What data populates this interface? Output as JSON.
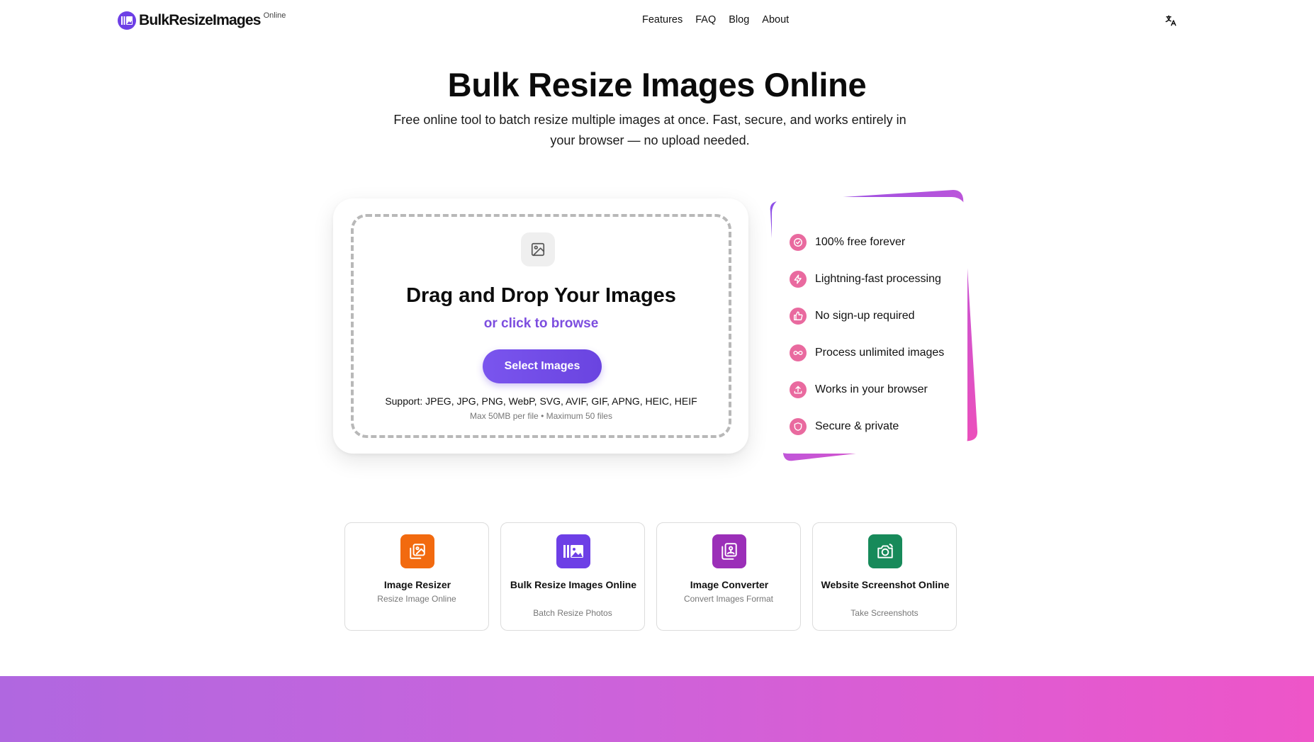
{
  "header": {
    "logo_text": "BulkResizeImages",
    "logo_sup": "Online",
    "nav": [
      "Features",
      "FAQ",
      "Blog",
      "About"
    ]
  },
  "hero": {
    "title": "Bulk Resize Images Online",
    "subtitle": "Free online tool to batch resize multiple images at once. Fast, secure, and works entirely in your browser — no upload needed."
  },
  "upload": {
    "title": "Drag and Drop Your Images",
    "browse": "or click to browse",
    "button": "Select Images",
    "support": "Support: JPEG, JPG, PNG, WebP, SVG, AVIF, GIF, APNG, HEIC, HEIF",
    "limits": "Max 50MB per file • Maximum 50 files"
  },
  "features": [
    {
      "label": "100% free forever",
      "icon": "check-badge-icon"
    },
    {
      "label": "Lightning-fast processing",
      "icon": "lightning-icon"
    },
    {
      "label": "No sign-up required",
      "icon": "thumbs-up-icon"
    },
    {
      "label": "Process unlimited images",
      "icon": "infinity-icon"
    },
    {
      "label": "Works in your browser",
      "icon": "upload-icon"
    },
    {
      "label": "Secure & private",
      "icon": "shield-icon"
    }
  ],
  "tools": [
    {
      "title": "Image Resizer",
      "sub": "Resize Image Online",
      "color": "#f26a0f"
    },
    {
      "title": "Bulk Resize Images Online",
      "sub": "Batch Resize Photos",
      "color": "#6d3fe6"
    },
    {
      "title": "Image Converter",
      "sub": "Convert Images Format",
      "color": "#9b2fb8"
    },
    {
      "title": "Website Screenshot Online",
      "sub": "Take Screenshots",
      "color": "#178a5a"
    }
  ],
  "colors": {
    "accent": "#6d3fe6",
    "feature_icon": "#e96a9f",
    "band_start": "#b067e0",
    "band_end": "#ee55c8"
  }
}
